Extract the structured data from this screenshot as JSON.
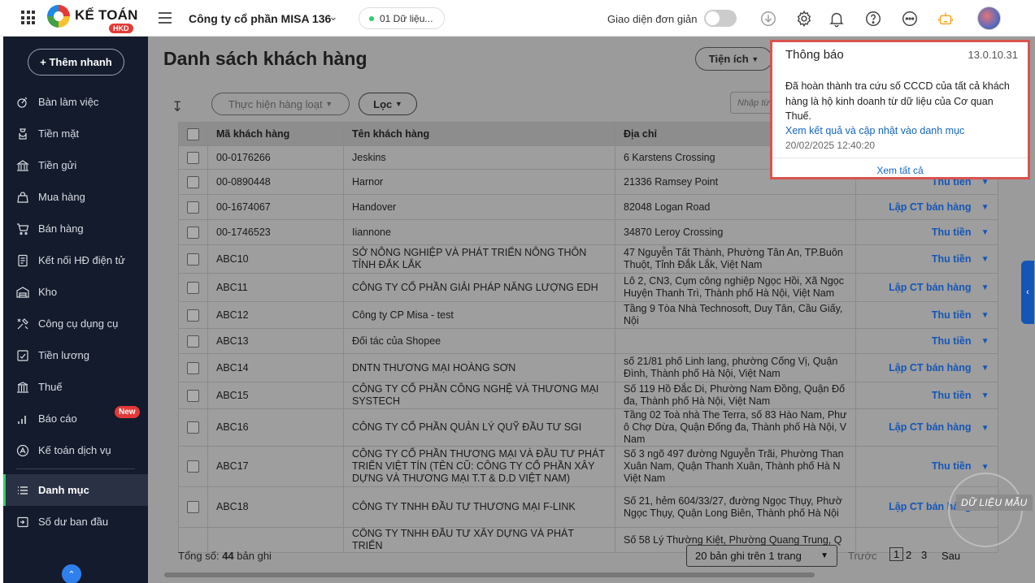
{
  "header": {
    "brand": "KẾ TOÁN",
    "brand_badge": "HKD",
    "company": "Công ty cổ phần MISA 136",
    "data_label": "01 Dữ liệu...",
    "simple_mode_label": "Giao diện đơn giản"
  },
  "sidebar": {
    "quick_add": "+ Thêm nhanh",
    "items": [
      {
        "label": "Bàn làm việc",
        "icon": "desk-icon"
      },
      {
        "label": "Tiền mặt",
        "icon": "cash-icon"
      },
      {
        "label": "Tiền gửi",
        "icon": "bank-icon"
      },
      {
        "label": "Mua hàng",
        "icon": "shopping-bag-icon"
      },
      {
        "label": "Bán hàng",
        "icon": "cart-icon"
      },
      {
        "label": "Kết nối HĐ điện tử",
        "icon": "invoice-icon"
      },
      {
        "label": "Kho",
        "icon": "warehouse-icon"
      },
      {
        "label": "Công cụ dụng cụ",
        "icon": "tools-icon"
      },
      {
        "label": "Tiền lương",
        "icon": "payroll-icon"
      },
      {
        "label": "Thuế",
        "icon": "tax-icon"
      },
      {
        "label": "Báo cáo",
        "icon": "report-icon"
      },
      {
        "label": "Kế toán dịch vụ",
        "icon": "service-icon"
      },
      {
        "label": "Danh mục",
        "icon": "list-icon"
      },
      {
        "label": "Số dư ban đầu",
        "icon": "balance-icon"
      }
    ],
    "new_badge": "New"
  },
  "main": {
    "title": "Danh sách khách hàng",
    "utility_button": "Tiện ích",
    "bulk_action": "Thực hiện hàng loạt",
    "filter": "Lọc",
    "search_placeholder": "Nhập từ khóa"
  },
  "table": {
    "headers": {
      "code": "Mã khách hàng",
      "name": "Tên khách hàng",
      "address": "Địa chỉ"
    },
    "rows": [
      {
        "code": "00-0176266",
        "name": "Jeskins",
        "address": [
          "6 Karstens Crossing"
        ],
        "action": ""
      },
      {
        "code": "00-0890448",
        "name": "Harnor",
        "address": [
          "21336 Ramsey Point"
        ],
        "action": "Thu tiền"
      },
      {
        "code": "00-1674067",
        "name": "Handover",
        "address": [
          "82048 Logan Road"
        ],
        "action": "Lập CT bán hàng"
      },
      {
        "code": "00-1746523",
        "name": "Iiannone",
        "address": [
          "34870 Leroy Crossing"
        ],
        "action": "Thu tiền"
      },
      {
        "code": "ABC10",
        "name": "SỞ NÔNG NGHIỆP VÀ PHÁT TRIỂN NÔNG THÔN TỈNH ĐẮK LẮK",
        "address": [
          "47 Nguyễn Tất Thành, Phường Tân An, TP.Buôn",
          "Thuột, Tỉnh Đắk Lắk, Việt Nam"
        ],
        "action": "Thu tiền"
      },
      {
        "code": "ABC11",
        "name": "CÔNG TY CỔ PHẦN GIẢI PHÁP NĂNG LƯỢNG EDH",
        "address": [
          "Lô 2, CN3, Cụm công nghiệp Ngọc Hồi, Xã Ngọc",
          "Huyện Thanh Trì, Thành phố Hà Nội, Việt Nam"
        ],
        "action": "Lập CT bán hàng"
      },
      {
        "code": "ABC12",
        "name": "Công ty CP Misa - test",
        "address": [
          "Tầng 9 Tòa Nhà Technosoft, Duy Tân, Cầu Giấy,",
          "Nội"
        ],
        "action": "Thu tiền"
      },
      {
        "code": "ABC13",
        "name": "Đối tác của Shopee",
        "address": [
          ""
        ],
        "action": "Thu tiền"
      },
      {
        "code": "ABC14",
        "name": "DNTN THƯƠNG MẠI HOÀNG SƠN",
        "address": [
          "số 21/81 phố Linh lang, phường Cống Vị, Quận",
          "Đình, Thành phố Hà Nội, Việt Nam"
        ],
        "action": "Lập CT bán hàng"
      },
      {
        "code": "ABC15",
        "name": "CÔNG TY CỔ PHẦN CÔNG NGHỆ VÀ THƯƠNG MẠI SYSTECH",
        "address": [
          "Số 119 Hồ Đắc Di, Phường Nam Đồng, Quận Đố",
          "đa, Thành phố Hà Nội, Việt Nam"
        ],
        "action": "Thu tiền"
      },
      {
        "code": "ABC16",
        "name": "CÔNG TY CỔ PHẦN QUẢN LÝ QUỸ ĐẦU TƯ SGI",
        "address": [
          "Tầng 02 Toà nhà The Terra, số 83 Hào Nam, Phư",
          "ô Chợ Dừa, Quận Đống đa, Thành phố Hà Nội, V",
          "Nam"
        ],
        "action": "Lập CT bán hàng"
      },
      {
        "code": "ABC17",
        "name": "CÔNG TY CỔ PHẦN THƯƠNG MẠI VÀ ĐẦU TƯ PHÁT TRIỂN VIỆT TÍN (TÊN CŨ: CÔNG TY CỔ PHẦN  XÂY DỰNG VÀ THƯƠNG MẠI T.T & D.D VIỆT NAM)",
        "address": [
          "Số 3 ngõ 497 đường Nguyễn Trãi, Phường Than",
          "Xuân Nam, Quận Thanh Xuân, Thành phố Hà N",
          "Việt Nam"
        ],
        "action": "Thu tiền"
      },
      {
        "code": "ABC18",
        "name": "CÔNG TY TNHH ĐẦU TƯ THƯƠNG MẠI F-LINK",
        "address": [
          "Số 21, hẻm 604/33/27, đường Ngọc Thụy, Phườ",
          "Ngọc Thụy, Quận Long Biên, Thành phố Hà Nội"
        ],
        "action": "Lập CT bán hàng"
      },
      {
        "code": "",
        "name": "CÔNG TY TNHH ĐẦU TƯ XÂY DỰNG VÀ PHÁT TRIỂN",
        "address": [
          "Số 58 Lý Thường Kiệt, Phường Quang Trung, Q"
        ],
        "action": ""
      }
    ]
  },
  "footer": {
    "total_prefix": "Tổng số: ",
    "total_count": "44",
    "total_suffix": " bản ghi",
    "page_size": "20 bản ghi trên 1 trang",
    "prev": "Trước",
    "pages": [
      "1",
      "2",
      "3"
    ],
    "next": "Sau"
  },
  "watermark": "DỮ LIỆU MẪU",
  "notification": {
    "title": "Thông báo",
    "version": "13.0.10.31",
    "message": "Đã hoàn thành tra cứu số CCCD của tất cả khách hàng là hộ kinh doanh từ dữ liệu của Cơ quan Thuế.",
    "link": "Xem kết quả và cập nhật vào danh mục",
    "time": "20/02/2025 12:40:20",
    "view_all": "Xem tất cả"
  },
  "colors": {
    "sidebar_bg": "#141b2d",
    "active_accent": "#2ecc71",
    "link_blue": "#1456b8",
    "notification_border": "#d9534f",
    "badge_red": "#e53935"
  }
}
